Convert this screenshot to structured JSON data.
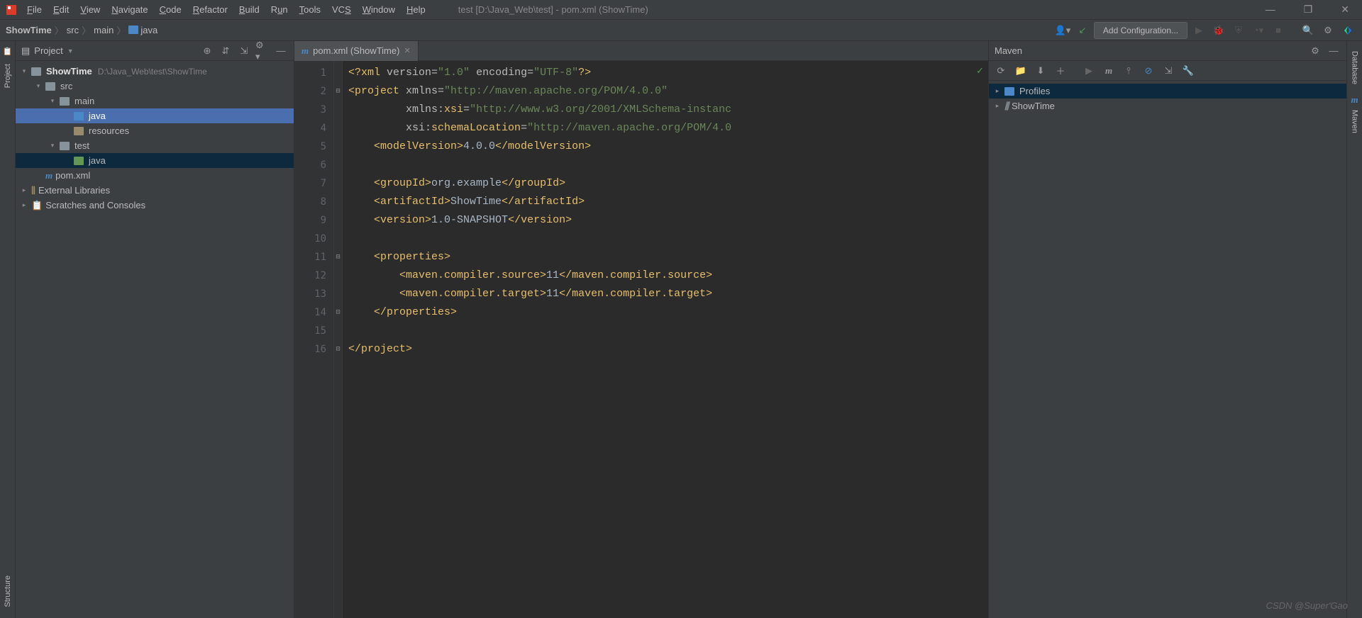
{
  "title_bar": {
    "menus": [
      "File",
      "Edit",
      "View",
      "Navigate",
      "Code",
      "Refactor",
      "Build",
      "Run",
      "Tools",
      "VCS",
      "Window",
      "Help"
    ],
    "title": "test [D:\\Java_Web\\test] - pom.xml (ShowTime)"
  },
  "nav_bar": {
    "crumbs": [
      "ShowTime",
      "src",
      "main",
      "java"
    ],
    "add_config_label": "Add Configuration..."
  },
  "project_panel": {
    "title": "Project",
    "tree": {
      "root_name": "ShowTime",
      "root_path": "D:\\Java_Web\\test\\ShowTime",
      "src": "src",
      "main": "main",
      "java": "java",
      "resources": "resources",
      "test": "test",
      "test_java": "java",
      "pom": "pom.xml",
      "ext_lib": "External Libraries",
      "scratches": "Scratches and Consoles"
    }
  },
  "editor": {
    "tab_label": "pom.xml (ShowTime)",
    "line_count": 16,
    "code": {
      "l1_pi_open": "<?xml",
      "l1_attr1": " version",
      "l1_val1": "\"1.0\"",
      "l1_attr2": " encoding",
      "l1_val2": "\"UTF-8\"",
      "l1_pi_close": "?>",
      "l2_open": "<project",
      "l2_attr": " xmlns",
      "l2_val": "\"http://maven.apache.org/POM/4.0.0\"",
      "l3_ns": "         xmlns:",
      "l3_attr": "xsi",
      "l3_val": "\"http://www.w3.org/2001/XMLSchema-instanc",
      "l4_ns": "         xsi:",
      "l4_attr": "schemaLocation",
      "l4_val": "\"http://maven.apache.org/POM/4.0",
      "l5_open": "    <modelVersion>",
      "l5_txt": "4.0.0",
      "l5_close": "</modelVersion>",
      "l7_open": "    <groupId>",
      "l7_txt": "org.example",
      "l7_close": "</groupId>",
      "l8_open": "    <artifactId>",
      "l8_txt": "ShowTime",
      "l8_close": "</artifactId>",
      "l9_open": "    <version>",
      "l9_txt": "1.0-SNAPSHOT",
      "l9_close": "</version>",
      "l11": "    <properties>",
      "l12_open": "        <maven.compiler.source>",
      "l12_txt": "11",
      "l12_close": "</maven.compiler.source>",
      "l13_open": "        <maven.compiler.target>",
      "l13_txt": "11",
      "l13_close": "</maven.compiler.target>",
      "l14": "    </properties>",
      "l16": "</project>"
    }
  },
  "maven_panel": {
    "title": "Maven",
    "profiles": "Profiles",
    "project": "ShowTime"
  },
  "left_gutter": {
    "project": "Project",
    "structure": "Structure"
  },
  "right_gutter": {
    "database": "Database",
    "maven": "Maven"
  },
  "watermark": "CSDN @Super'Gao"
}
